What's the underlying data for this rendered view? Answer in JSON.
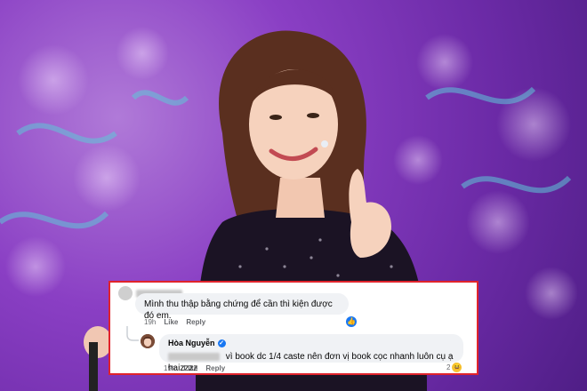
{
  "comments": [
    {
      "time": "19h",
      "like_label": "Like",
      "reply_label": "Reply",
      "text": "Mình thu thập bằng chứng để cần thì kiện được đó em.",
      "reaction_icon": "thumbs-up-icon"
    },
    {
      "author": "Hòa Nguyễn",
      "verified_icon": "verified-badge-icon",
      "text": "vì book dc 1/4 caste nên đơn vị book cọc nhanh luôn cụ ạ haizzzz",
      "time": "19h",
      "like_label": "Like",
      "reply_label": "Reply",
      "reaction_count": "2",
      "reaction_icon": "laughing-emoji-icon"
    }
  ],
  "colors": {
    "highlight_border": "#e0232c",
    "facebook_blue": "#1877f2",
    "bubble_bg": "#f0f2f5",
    "background_purple": "#8a3fc4"
  }
}
